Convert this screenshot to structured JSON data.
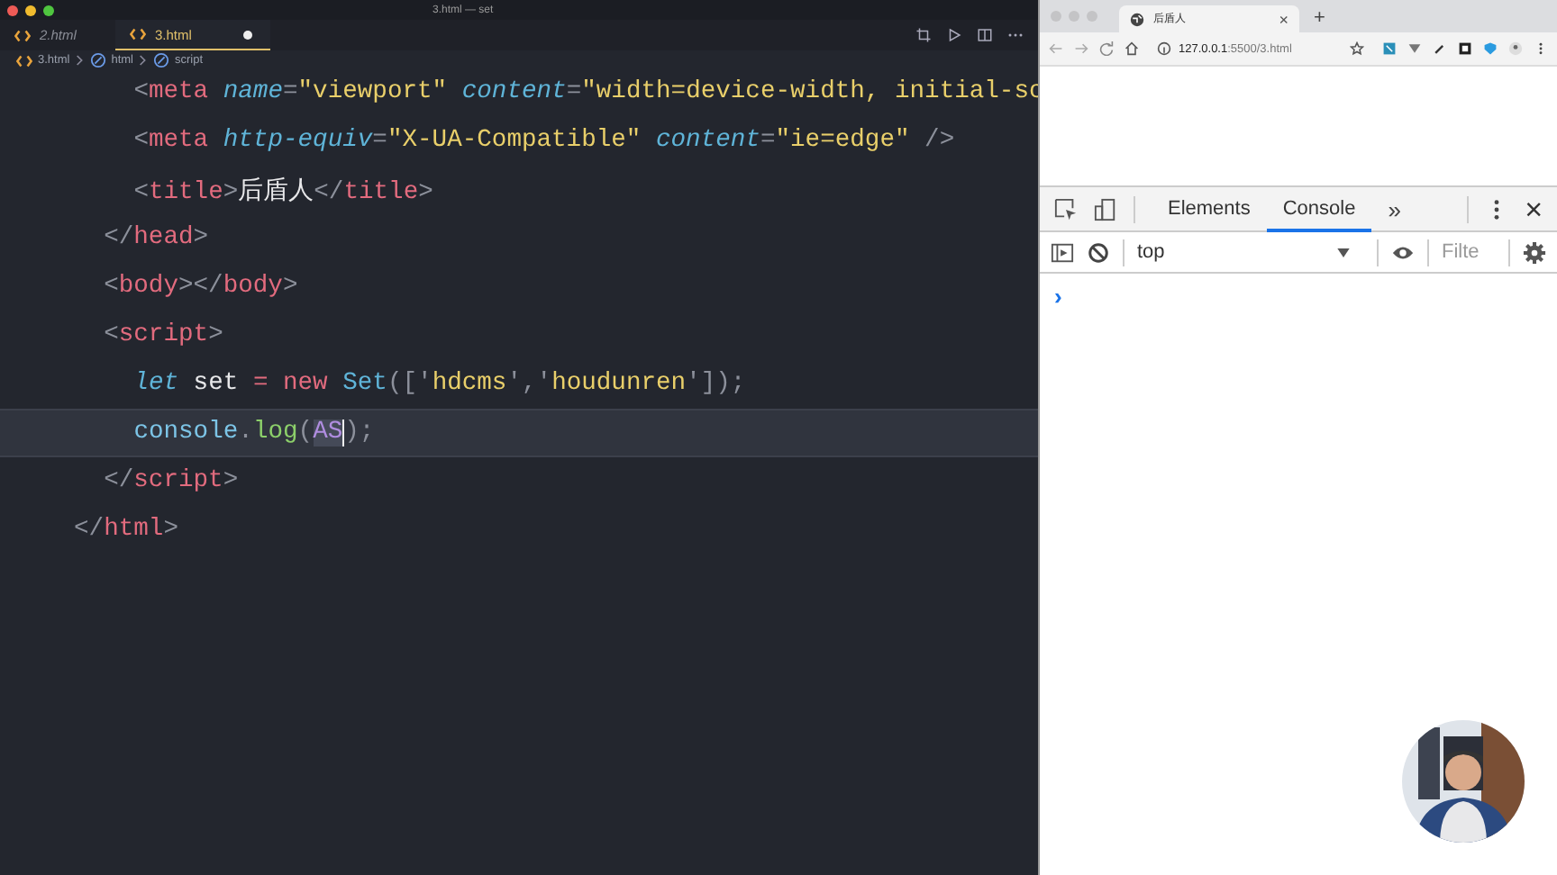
{
  "editor": {
    "window_title": "3.html — set",
    "tabs": [
      {
        "label": "2.html",
        "selected": false,
        "dirty": false
      },
      {
        "label": "3.html",
        "selected": true,
        "dirty": true
      }
    ],
    "breadcrumb": [
      "3.html",
      "html",
      "script"
    ],
    "lines": [
      {
        "children": [
          {
            "children": [
              {
                "active": false,
                "tokens": [
                  {
                    "kind": "bracket",
                    "text": "<"
                  },
                  {
                    "kind": "tag",
                    "text": "meta"
                  },
                  {
                    "kind": "attr",
                    "text": " name"
                  },
                  {
                    "kind": "bracket",
                    "text": "="
                  },
                  {
                    "kind": "string",
                    "text": "\"viewport\""
                  },
                  {
                    "kind": "attr",
                    "text": " content"
                  },
                  {
                    "kind": "bracket",
                    "text": "="
                  },
                  {
                    "kind": "string",
                    "text": "\"width=device-width, initial-sc"
                  }
                ]
              },
              {
                "active": false,
                "tokens": [
                  {
                    "kind": "bracket",
                    "text": "<"
                  },
                  {
                    "kind": "tag",
                    "text": "meta"
                  },
                  {
                    "kind": "attr",
                    "text": " http-equiv"
                  },
                  {
                    "kind": "bracket",
                    "text": "="
                  },
                  {
                    "kind": "string",
                    "text": "\"X-UA-Compatible\""
                  },
                  {
                    "kind": "attr",
                    "text": " content"
                  },
                  {
                    "kind": "bracket",
                    "text": "="
                  },
                  {
                    "kind": "string",
                    "text": "\"ie=edge\""
                  },
                  {
                    "kind": "bracket",
                    "text": " />"
                  }
                ]
              },
              {
                "active": false,
                "tokens": [
                  {
                    "kind": "bracket",
                    "text": "<"
                  },
                  {
                    "kind": "tag",
                    "text": "title"
                  },
                  {
                    "kind": "bracket",
                    "text": ">"
                  },
                  {
                    "kind": "plain",
                    "text": "后盾人"
                  },
                  {
                    "kind": "bracket",
                    "text": "</"
                  },
                  {
                    "kind": "tag",
                    "text": "title"
                  },
                  {
                    "kind": "bracket",
                    "text": ">"
                  }
                ]
              }
            ]
          },
          {
            "active": false,
            "tokens": [
              {
                "kind": "bracket",
                "text": "</"
              },
              {
                "kind": "tag",
                "text": "head"
              },
              {
                "kind": "bracket",
                "text": ">"
              }
            ]
          },
          {
            "active": false,
            "tokens": [
              {
                "kind": "bracket",
                "text": "<"
              },
              {
                "kind": "tag",
                "text": "body"
              },
              {
                "kind": "bracket",
                "text": "></"
              },
              {
                "kind": "tag",
                "text": "body"
              },
              {
                "kind": "bracket",
                "text": ">"
              }
            ]
          },
          {
            "active": false,
            "tokens": [
              {
                "kind": "bracket",
                "text": "<"
              },
              {
                "kind": "tag",
                "text": "script"
              },
              {
                "kind": "bracket",
                "text": ">"
              }
            ],
            "children": [
              {
                "active": false,
                "tokens": [
                  {
                    "kind": "keyword",
                    "text": "let"
                  },
                  {
                    "kind": "plain",
                    "text": " set "
                  },
                  {
                    "kind": "operator",
                    "text": "="
                  },
                  {
                    "kind": "new",
                    "text": " new"
                  },
                  {
                    "kind": "class",
                    "text": " Set"
                  },
                  {
                    "kind": "bracket",
                    "text": "(['"
                  },
                  {
                    "kind": "string",
                    "text": "hdcms"
                  },
                  {
                    "kind": "bracket",
                    "text": "','"
                  },
                  {
                    "kind": "string",
                    "text": "houdunren"
                  },
                  {
                    "kind": "bracket",
                    "text": "']);"
                  }
                ]
              },
              {
                "active": true,
                "tokens": [
                  {
                    "kind": "object",
                    "text": "console"
                  },
                  {
                    "kind": "bracket",
                    "text": "."
                  },
                  {
                    "kind": "method",
                    "text": "log"
                  },
                  {
                    "kind": "bracket",
                    "text": "("
                  },
                  {
                    "kind": "selection",
                    "text": "AS"
                  },
                  {
                    "kind": "bracket",
                    "text": ");"
                  }
                ]
              }
            ]
          },
          {
            "active": false,
            "tokens": [
              {
                "kind": "bracket",
                "text": "</"
              },
              {
                "kind": "tag",
                "text": "script"
              },
              {
                "kind": "bracket",
                "text": ">"
              }
            ]
          }
        ]
      },
      {
        "active": false,
        "tokens": [
          {
            "kind": "bracket",
            "text": "</"
          },
          {
            "kind": "tag",
            "text": "html"
          },
          {
            "kind": "bracket",
            "text": ">"
          }
        ]
      }
    ]
  },
  "browser": {
    "tab_title": "后盾人",
    "tab_close": "×",
    "new_tab": "+",
    "address": "**127.0.0.1**:5500/3.html",
    "devtools": {
      "tabs": [
        {
          "label": "Elements",
          "selected": false
        },
        {
          "label": "Console",
          "selected": true
        }
      ],
      "more": "»",
      "close": "×",
      "context": "top",
      "filter_placeholder": "Filte",
      "prompt": "›"
    }
  }
}
